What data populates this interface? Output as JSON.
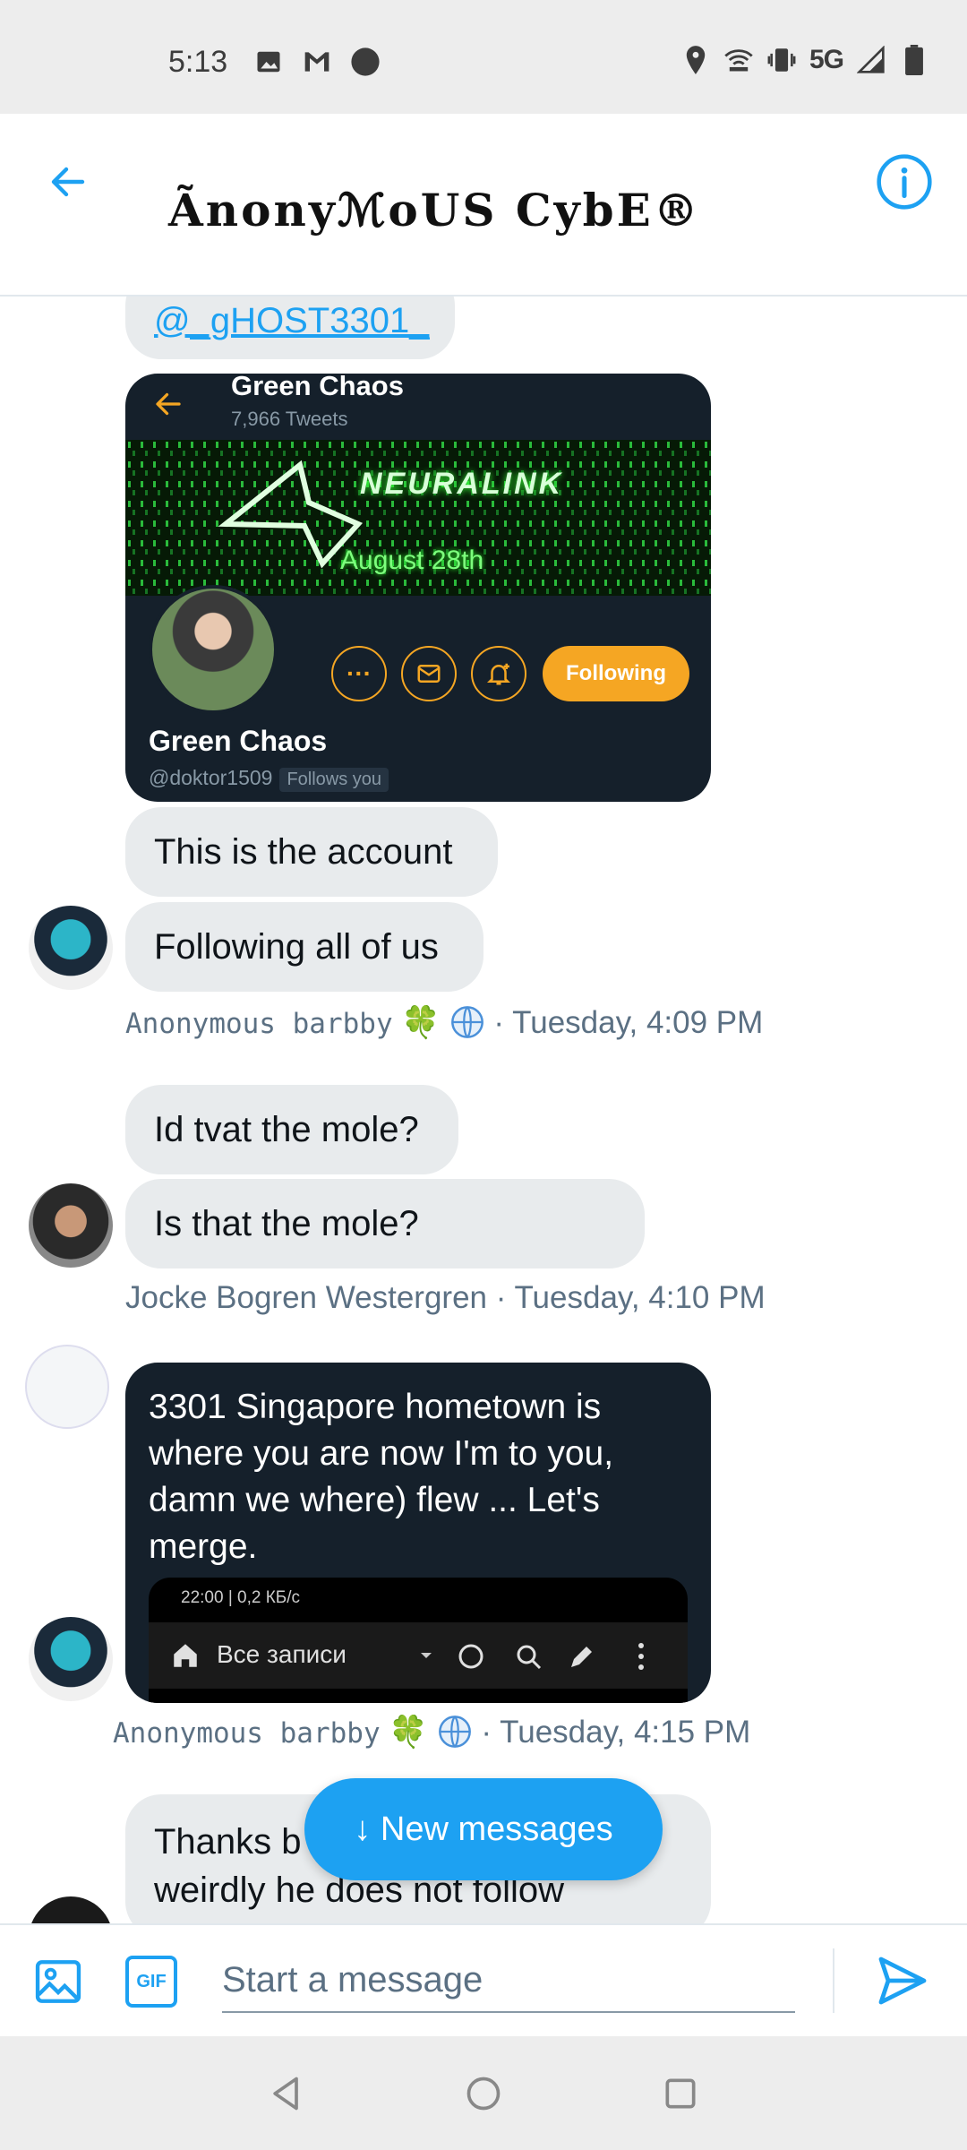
{
  "status_bar": {
    "time": "5:13",
    "network": "5G"
  },
  "header": {
    "title": "ÃnonyℳoUS CybE®",
    "back_icon": "arrow-left-icon",
    "info_icon": "info-circle-icon"
  },
  "messages": {
    "mention": "@_gHOST3301_",
    "profile_card": {
      "name_top": "Green Chaos",
      "tweets": "7,966 Tweets",
      "banner_title": "NEURALINK",
      "banner_subtitle": "August 28th",
      "follow_label": "Following",
      "name": "Green Chaos",
      "handle": "@doktor1509",
      "follows_badge": "Follows you",
      "more_label": "···"
    },
    "group1": {
      "msg1": "This is the account",
      "msg2": "Following all of us",
      "sender": "Anonymous barbby",
      "time": "· Tuesday, 4:09 PM",
      "emoji": "🍀"
    },
    "group2": {
      "msg1": "Id tvat the mole?",
      "msg2": "Is that the mole?",
      "meta": "Jocke Bogren Westergren · Tuesday, 4:10 PM"
    },
    "group3": {
      "text": "3301 Singapore hometown is where you are now I'm to you, damn we where) flew ... Let's merge.",
      "shot_status": "22:00 | 0,2 КБ/с",
      "shot_title": "Все записи",
      "sender": "Anonymous barbby",
      "time": "· Tuesday, 4:15 PM",
      "emoji": "🍀"
    },
    "group4": {
      "text_line1": "Thanks b",
      "text_line2": "weirdly he does not follow"
    }
  },
  "new_messages_label": "↓ New messages",
  "composer": {
    "placeholder": "Start a message",
    "gif_label": "GIF"
  },
  "colors": {
    "accent": "#1da1f2",
    "bubble": "#e8ebed",
    "dark_bubble": "#15202b",
    "follow": "#f5a623"
  }
}
